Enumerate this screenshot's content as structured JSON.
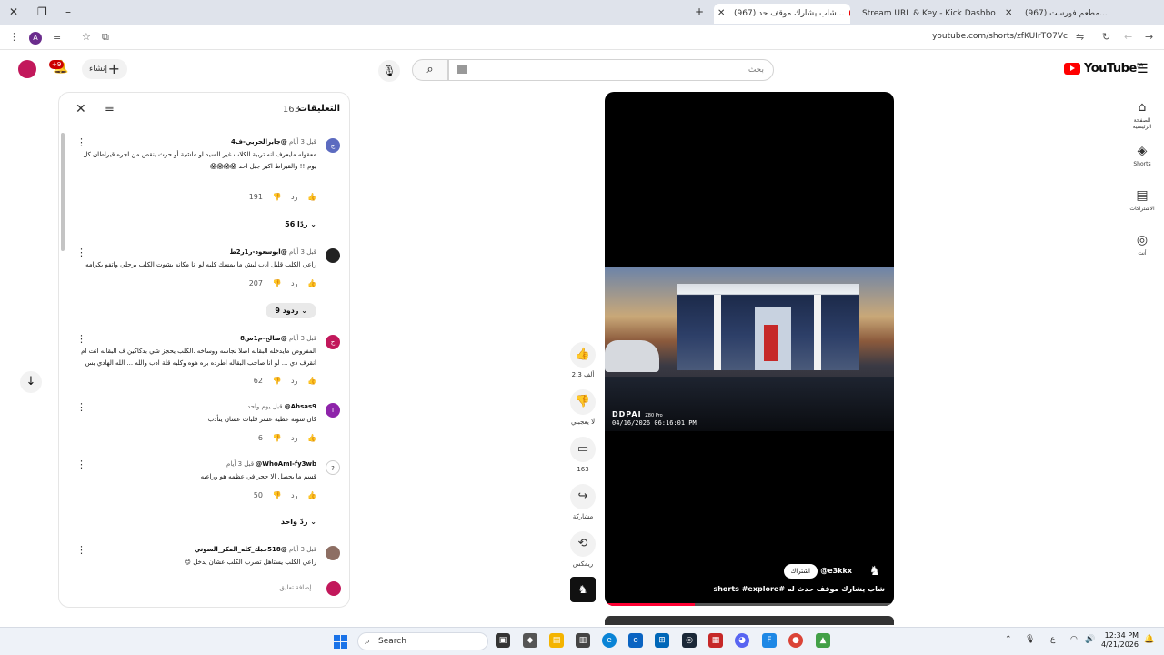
{
  "browser": {
    "tabs": [
      {
        "title": "(967) شاب يشارك موقف حد...",
        "active": true
      },
      {
        "title": "Stream URL & Key - Kick Dashboard"
      },
      {
        "title": "(967) مطعم فورست..."
      }
    ],
    "url": "youtube.com/shorts/zfKUIrTO7Vc",
    "profile_initial": "A"
  },
  "header": {
    "create_label": "إنشاء",
    "notifications_badge": "+9",
    "search_placeholder": "بحث",
    "logo_text": "YouTube",
    "logo_region": "SA"
  },
  "guide": [
    {
      "icon": "home-icon",
      "glyph": "⌂",
      "label": "الصفحة الرئيسية"
    },
    {
      "icon": "shorts-icon",
      "glyph": "◈",
      "label": "Shorts"
    },
    {
      "icon": "subscriptions-icon",
      "glyph": "▤",
      "label": "الاشتراكات"
    },
    {
      "icon": "you-icon",
      "glyph": "◎",
      "label": "أنت"
    }
  ],
  "comments": {
    "title": "التعليقات",
    "count": "163",
    "add_placeholder": "إضافة تعليق...",
    "items": [
      {
        "author": "@جابرالحربي-ف4",
        "time": "قبل 3 أيام",
        "avatar_letter": "ج",
        "avatar_color": "#5c6bc0",
        "text": "معقوله مايعرف انه تربية الكلاب غير للسيد او ماشية أو حرث ينقص من اجره قيراطان كل يوم!!! والقيراط اكبر جبل احد 😱😱😱😱",
        "likes": "191",
        "reply": "رد",
        "replies_label": "56 ردًا"
      },
      {
        "author": "@ابوسعود-ر1ر2ط",
        "time": "قبل 3 أيام",
        "avatar_letter": "",
        "avatar_color": "#222222",
        "text": "راعي الكلب قليل ادب ليش ما يمسك كلبه لو انا مكانه بشوت الكلب برجلي واتفو بكرامه",
        "likes": "207",
        "reply": "رد",
        "replies_label": "9 ردود"
      },
      {
        "author": "@صالح-م1س8",
        "time": "قبل 3 أيام",
        "avatar_letter": "ح",
        "avatar_color": "#c2185b",
        "text": "المفروض مايدخله البقاله اصلا نجاسه ووساخه .الكلب يحجز شي بدكاكين ف البقاله انت ام انقرف ذي ... لو انا صاحب البقاله اطرده بره هوه وكلبه قلة ادب والله ... الله الهادي بس",
        "likes": "62",
        "reply": "رد",
        "replies_label": ""
      },
      {
        "author": "@Ahsas9",
        "time": "قبل يوم واحد",
        "avatar_letter": "I",
        "avatar_color": "#8e24aa",
        "text": "كان شوته عطيه عشر قلبات عشان يتأدب",
        "likes": "6",
        "reply": "رد",
        "replies_label": ""
      },
      {
        "author": "@WhoAmI-fy3wb",
        "time": "قبل 3 أيام",
        "avatar_letter": "?",
        "avatar_color": "#ffffff",
        "text": "قسم ما يحصل الا حجر في عظمه هو وراعيه",
        "likes": "50",
        "reply": "رد",
        "replies_label": "ردّ واحد"
      },
      {
        "author": "@518حبك_كله_المكر_السوني",
        "time": "قبل 3 أيام",
        "avatar_letter": "",
        "avatar_color": "#8d6e63",
        "text": "راعي الكلب يستاهل تضرب الكلب عشان يدخل 😊",
        "likes": "",
        "reply": "",
        "replies_label": ""
      }
    ]
  },
  "video": {
    "dashcam_brand": "DDPAI",
    "dashcam_model": "Z80 Pro",
    "timestamp": "04/16/2026 06:16:01 PM",
    "channel": "@e3kkx",
    "subscribe_label": "اشتراك",
    "title": "شاب يشارك موقف حدث له #shorts #explore",
    "progress": 0.31
  },
  "actions": [
    {
      "icon": "like-icon",
      "glyph": "👍",
      "label": "2.3 ألف"
    },
    {
      "icon": "dislike-icon",
      "glyph": "👎",
      "label": "لا يعجبني"
    },
    {
      "icon": "comment-icon",
      "glyph": "▭",
      "label": "163"
    },
    {
      "icon": "share-icon",
      "glyph": "↪",
      "label": "مشاركة"
    },
    {
      "icon": "remix-icon",
      "glyph": "⟲",
      "label": "ريمكس"
    }
  ],
  "taskbar": {
    "search_label": "Search",
    "time": "12:34 PM",
    "date": "4/21/2026",
    "lang": "ع"
  }
}
